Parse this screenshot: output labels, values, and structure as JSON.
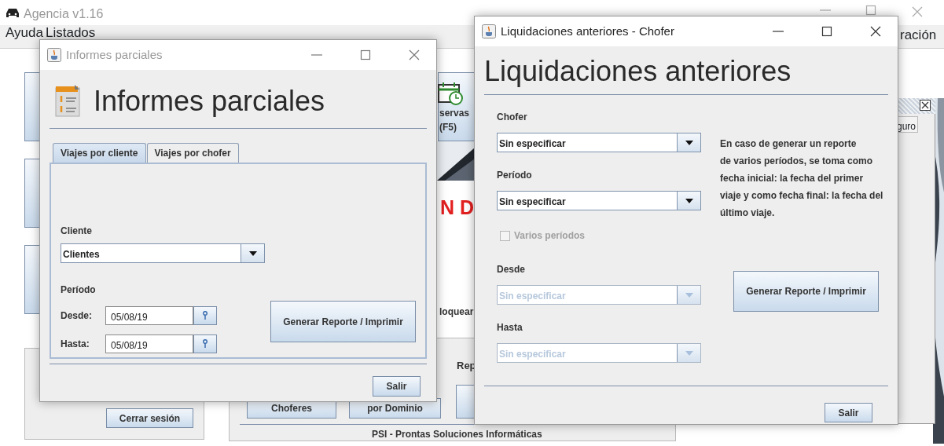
{
  "main_window": {
    "title": "Agencia v1.16",
    "menu": [
      "Ayuda",
      "Listados",
      "ración"
    ],
    "reservas_button": [
      "servas",
      "(F5)"
    ],
    "banner": "N D",
    "block_label": "loquear",
    "reports_label": "Rep",
    "report_buttons": [
      "Choferes",
      "por Dominio"
    ],
    "logout_button": "Cerrar sesión",
    "footer": "PSI - Prontas Soluciones Informáticas",
    "side_cell": "guro"
  },
  "informes_window": {
    "title": "Informes parciales",
    "heading": "Informes parciales",
    "tabs": [
      {
        "label": "Viajes por cliente",
        "selected": true
      },
      {
        "label": "Viajes por chofer",
        "selected": false
      }
    ],
    "cliente_label": "Cliente",
    "cliente_combo": {
      "value": "Clientes",
      "disabled": false
    },
    "periodo_label": "Período",
    "dates": [
      {
        "label": "Desde:",
        "value": "05/08/19"
      },
      {
        "label": "Hasta:",
        "value": "05/08/19"
      }
    ],
    "generate_button": "Generar Reporte / Imprimir",
    "exit_button": "Salir"
  },
  "liquidaciones_window": {
    "title": "Liquidaciones anteriores - Chofer",
    "heading": "Liquidaciones anteriores",
    "fields": [
      {
        "label": "Chofer",
        "value": "Sin especificar",
        "disabled": false
      },
      {
        "label": "Período",
        "value": "Sin especificar",
        "disabled": false
      }
    ],
    "checkbox": {
      "label": "Varios períodos",
      "checked": false,
      "disabled": true
    },
    "range_fields": [
      {
        "label": "Desde",
        "value": "Sin especificar",
        "disabled": true
      },
      {
        "label": "Hasta",
        "value": "Sin especificar",
        "disabled": true
      }
    ],
    "info_lines": [
      "En caso de generar un reporte",
      "de varios períodos, se toma como",
      "fecha inicial: la fecha del primer",
      "viaje y como fecha final: la fecha del",
      "último viaje."
    ],
    "generate_button": "Generar Reporte / Imprimir",
    "exit_button": "Salir"
  }
}
